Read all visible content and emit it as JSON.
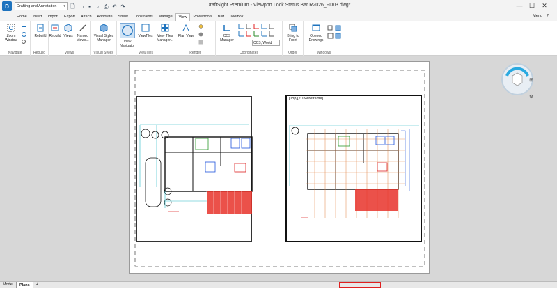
{
  "titlebar": {
    "workspace": "Drafting and Annotation",
    "title": "DraftSight Premium - Viewport Lock Status Bar R2026_FD03.dwg*",
    "minimize": "—",
    "maximize": "☐",
    "close": "✕"
  },
  "tabs": [
    "Home",
    "Insert",
    "Import",
    "Export",
    "Attach",
    "Annotate",
    "Sheet",
    "Constraints",
    "Manage",
    "View",
    "Powertools",
    "BIM",
    "Toolbox"
  ],
  "active_tab": "View",
  "menu_right": {
    "menu": "Menu",
    "help": "?"
  },
  "ribbon": {
    "navigate": {
      "title": "Navigate",
      "zoom_window": "Zoom\nWindow"
    },
    "rebuild": {
      "title": "Rebuild",
      "rebuild": "Rebuild"
    },
    "views": {
      "title": "Views",
      "rebuild2": "Rebuild",
      "views": "Views",
      "named_views": "Named\nViews..."
    },
    "visual_styles": {
      "title": "Visual Styles",
      "manager": "Visual Styles\nManager"
    },
    "viewtiles": {
      "title": "ViewTiles",
      "view_navigator": "View\nNavigator",
      "viewtiles": "ViewTiles",
      "viewtiles_manager": "View Tiles\nManager..."
    },
    "render": {
      "title": "Render",
      "plan_view": "Plan View"
    },
    "coordinates": {
      "title": "Coordinates",
      "ccs_manager": "CCS\nManager",
      "ucs_value": "CCS, World"
    },
    "order": {
      "title": "Order",
      "bring_to_front": "Bring to\nFront"
    },
    "windows": {
      "title": "Windows",
      "opened_drawings": "Opened\nDrawings"
    }
  },
  "viewport2": {
    "label": "[Top][2D Wireframe]"
  },
  "layout_tabs": [
    "Model",
    "Plans"
  ],
  "active_layout": "Plans",
  "add_tab": "+",
  "colors": {
    "accent": "#1e73be",
    "highlight": "#e02020",
    "wall_fill": "#e8332a"
  }
}
